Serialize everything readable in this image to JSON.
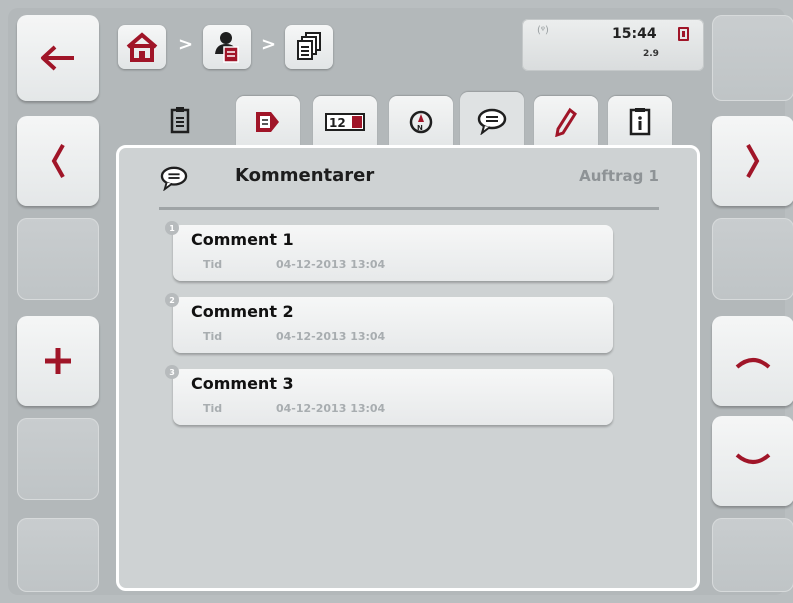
{
  "status": {
    "time": "15:44",
    "version": "2.9",
    "signal_icon": "signal-icon",
    "battery_icon": "battery-icon"
  },
  "breadcrumb": {
    "separator": ">",
    "items": [
      {
        "icon": "home-icon"
      },
      {
        "icon": "customer-icon"
      },
      {
        "icon": "orders-icon"
      }
    ]
  },
  "tabs": [
    {
      "icon": "clipboard-icon",
      "active": false
    },
    {
      "icon": "document-arrow-icon",
      "active": false
    },
    {
      "icon": "counter-icon",
      "active": false
    },
    {
      "icon": "compass-icon",
      "active": false
    },
    {
      "icon": "comment-icon",
      "active": true
    },
    {
      "icon": "pencil-icon",
      "active": false
    },
    {
      "icon": "info-icon",
      "active": false
    }
  ],
  "panel": {
    "title": "Kommentarer",
    "order": "Auftrag 1",
    "title_icon": "comment-icon"
  },
  "comments": [
    {
      "index": "1",
      "name": "Comment 1",
      "label": "Tid",
      "value": "04-12-2013 13:04"
    },
    {
      "index": "2",
      "name": "Comment 2",
      "label": "Tid",
      "value": "04-12-2013 13:04"
    },
    {
      "index": "3",
      "name": "Comment 3",
      "label": "Tid",
      "value": "04-12-2013 13:04"
    }
  ],
  "colors": {
    "accent": "#a01528",
    "background": "#b9bec0",
    "panel": "#ced2d3"
  }
}
